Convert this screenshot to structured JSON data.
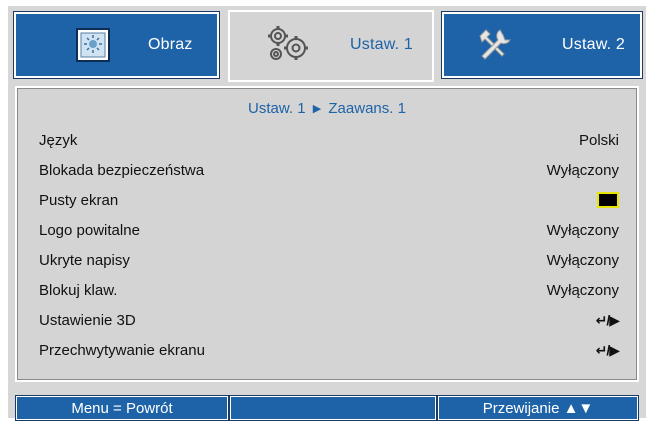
{
  "tabs": [
    {
      "label": "Obraz",
      "icon": "image-icon"
    },
    {
      "label": "Ustaw. 1",
      "icon": "gears-icon"
    },
    {
      "label": "Ustaw. 2",
      "icon": "tools-icon"
    }
  ],
  "breadcrumb": {
    "part1": "Ustaw. 1",
    "separator": "▶",
    "part2": "Zaawans. 1"
  },
  "settings": [
    {
      "label": "Język",
      "value": "Polski"
    },
    {
      "label": "Blokada bezpieczeństwa",
      "value": "Wyłączony"
    },
    {
      "label": "Pusty ekran",
      "value": ""
    },
    {
      "label": "Logo powitalne",
      "value": "Wyłączony"
    },
    {
      "label": "Ukryte napisy",
      "value": "Wyłączony"
    },
    {
      "label": "Blokuj klaw.",
      "value": "Wyłączony"
    },
    {
      "label": "Ustawienie 3D",
      "value": "↵/▶"
    },
    {
      "label": "Przechwytywanie ekranu",
      "value": "↵/▶"
    }
  ],
  "blank_screen_color": "#000000",
  "bottom_bar": {
    "left": "Menu = Powrót",
    "middle": "",
    "right": "Przewijanie ▲▼"
  },
  "colors": {
    "accent": "#1e63a8",
    "panel": "#d4d4d4",
    "highlight": "#e8e800"
  }
}
